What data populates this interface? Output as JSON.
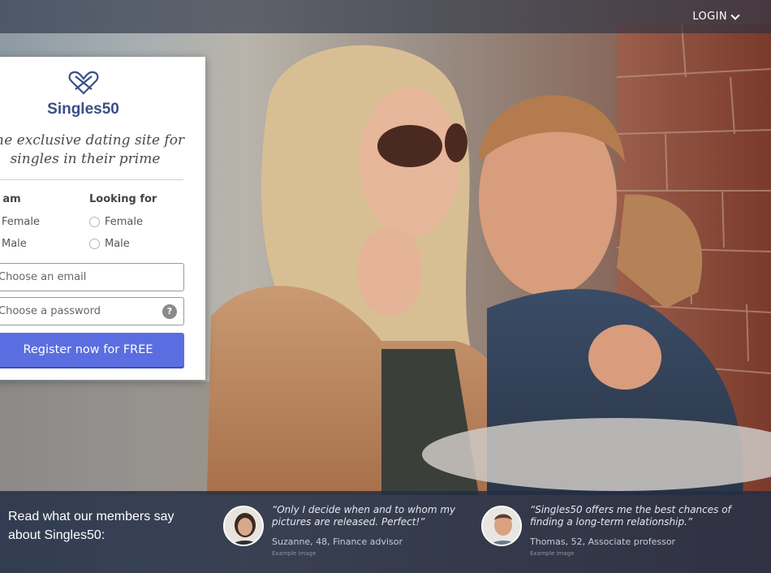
{
  "header": {
    "login_label": "LOGIN"
  },
  "card": {
    "brand": "Singles50",
    "tagline_line1": "The exclusive dating site for",
    "tagline_line2": "singles in their prime",
    "i_am_heading": "I am",
    "looking_for_heading": "Looking for",
    "i_am_options": [
      "Female",
      "Male"
    ],
    "looking_for_options": [
      "Female",
      "Male"
    ],
    "email_placeholder": "Choose an email",
    "password_placeholder": "Choose a password",
    "help_icon_label": "?",
    "register_button": "Register now for FREE"
  },
  "testimonials": {
    "title": "Read what our members say about Singles50:",
    "items": [
      {
        "quote": "“Only I decide when and to whom my pictures are released. Perfect!”",
        "author": "Suzanne, 48, Finance advisor",
        "note": "Example image"
      },
      {
        "quote": "“Singles50 offers me the best chances of finding a long-term relationship.”",
        "author": "Thomas, 52, Associate professor",
        "note": "Example image"
      }
    ]
  },
  "colors": {
    "brand": "#3a4f86",
    "button": "#5b6ee1",
    "strip": "#242d44"
  },
  "icons": [
    "heart-logo-icon",
    "chevron-down-icon",
    "help-icon",
    "radio-icon"
  ]
}
